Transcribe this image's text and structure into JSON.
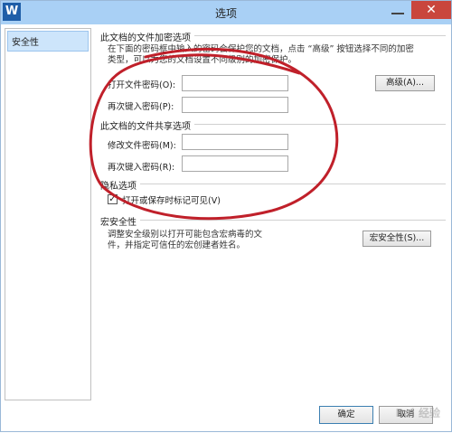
{
  "window": {
    "title": "选项",
    "app_icon_letter": "W",
    "close_glyph": "✕"
  },
  "sidebar": {
    "items": [
      {
        "label": "安全性"
      }
    ]
  },
  "encryption": {
    "heading": "此文档的文件加密选项",
    "description_line1": "在下面的密码框中输入的密码会保护您的文档，点击 “高级” 按钮选择不同的加密",
    "description_line2": "类型，可以为您的文档设置不同级别的加密保护。",
    "open_password_label": "打开文件密码(O):",
    "open_password_value": "",
    "reenter_label": "再次键入密码(P):",
    "reenter_value": "",
    "advanced_button": "高级(A)..."
  },
  "sharing": {
    "heading": "此文档的文件共享选项",
    "modify_password_label": "修改文件密码(M):",
    "modify_password_value": "",
    "reenter_label": "再次键入密码(R):",
    "reenter_value": ""
  },
  "privacy": {
    "heading": "隐私选项",
    "checkbox_label": "打开或保存时标记可见(V)",
    "checked": true
  },
  "macro": {
    "heading": "宏安全性",
    "description_line1": "调整安全级别以打开可能包含宏病毒的文",
    "description_line2": "件，并指定可信任的宏创建者姓名。",
    "button": "宏安全性(S)..."
  },
  "footer": {
    "ok_button": "确定",
    "cancel_button": "取消"
  },
  "watermark": "Bai 经验",
  "colors": {
    "titlebar": "#a9d0f5",
    "close": "#c9463d",
    "annotation": "#c0202a"
  }
}
